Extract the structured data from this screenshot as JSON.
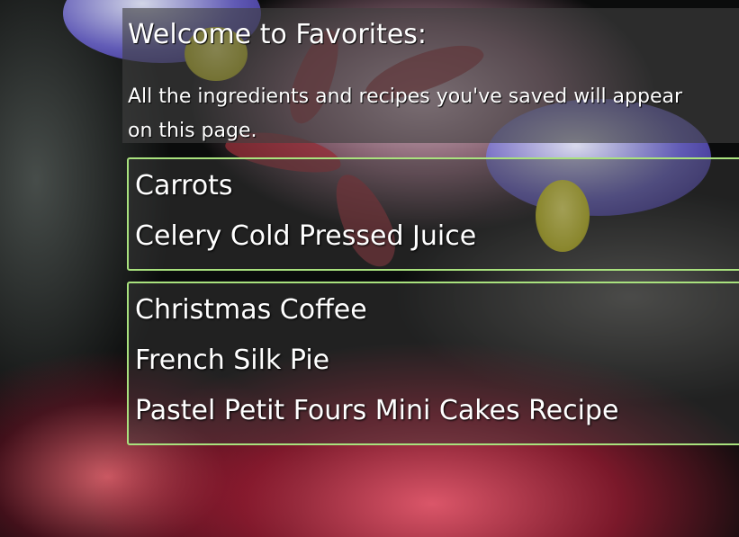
{
  "welcome": {
    "title": "Welcome to Favorites:",
    "description_line1": "All the ingredients and recipes you've saved will appear",
    "description_line2": "on this page."
  },
  "ingredients": {
    "items": [
      {
        "label": "Carrots"
      },
      {
        "label": "Celery Cold Pressed Juice"
      }
    ]
  },
  "recipes": {
    "items": [
      {
        "label": "Christmas Coffee"
      },
      {
        "label": "French Silk Pie"
      },
      {
        "label": "Pastel Petit Fours Mini Cakes Recipe"
      }
    ]
  },
  "colors": {
    "accent_border": "#a9e27e",
    "panel_bg": "#404040",
    "text": "#ffffff"
  }
}
